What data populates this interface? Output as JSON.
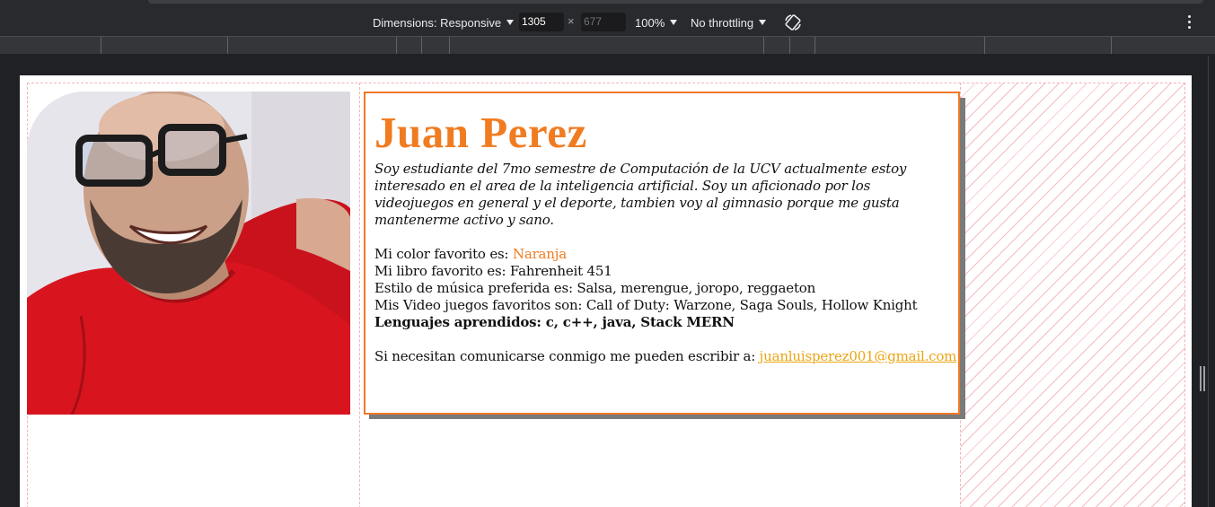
{
  "toolbar": {
    "dimensions_label": "Dimensions: Responsive",
    "width_value": "1305",
    "height_placeholder": "677",
    "times_symbol": "×",
    "zoom": "100%",
    "throttling": "No throttling"
  },
  "profile": {
    "name": "Juan Perez",
    "bio": "Soy estudiante del 7mo semestre de Computación de la UCV actualmente estoy interesado en el area de la inteligencia artificial. Soy un aficionado por los videojuegos en general y el deporte, tambien voy al gimnasio porque me gusta mantenerme activo y sano.",
    "color_label": "Mi color favorito es: ",
    "color_value": "Naranja",
    "book": "Mi libro favorito es: Fahrenheit 451",
    "music": "Estilo de música preferida es: Salsa, merengue, joropo, reggaeton",
    "games": "Mis Video juegos favoritos son: Call of Duty: Warzone, Saga Souls, Hollow Knight",
    "languages": "Lenguajes aprendidos: c, c++, java, Stack MERN",
    "contact_label": "Si necesitan comunicarse conmigo me pueden escribir a: ",
    "email": "juanluisperez001@gmail.com"
  },
  "colors": {
    "accent": "#f07c22",
    "link": "#eba410",
    "card_border": "#f07827",
    "shirt": "#d8151f"
  },
  "icons": {
    "rotate": "rotate-icon",
    "more": "kebab-menu-icon"
  }
}
